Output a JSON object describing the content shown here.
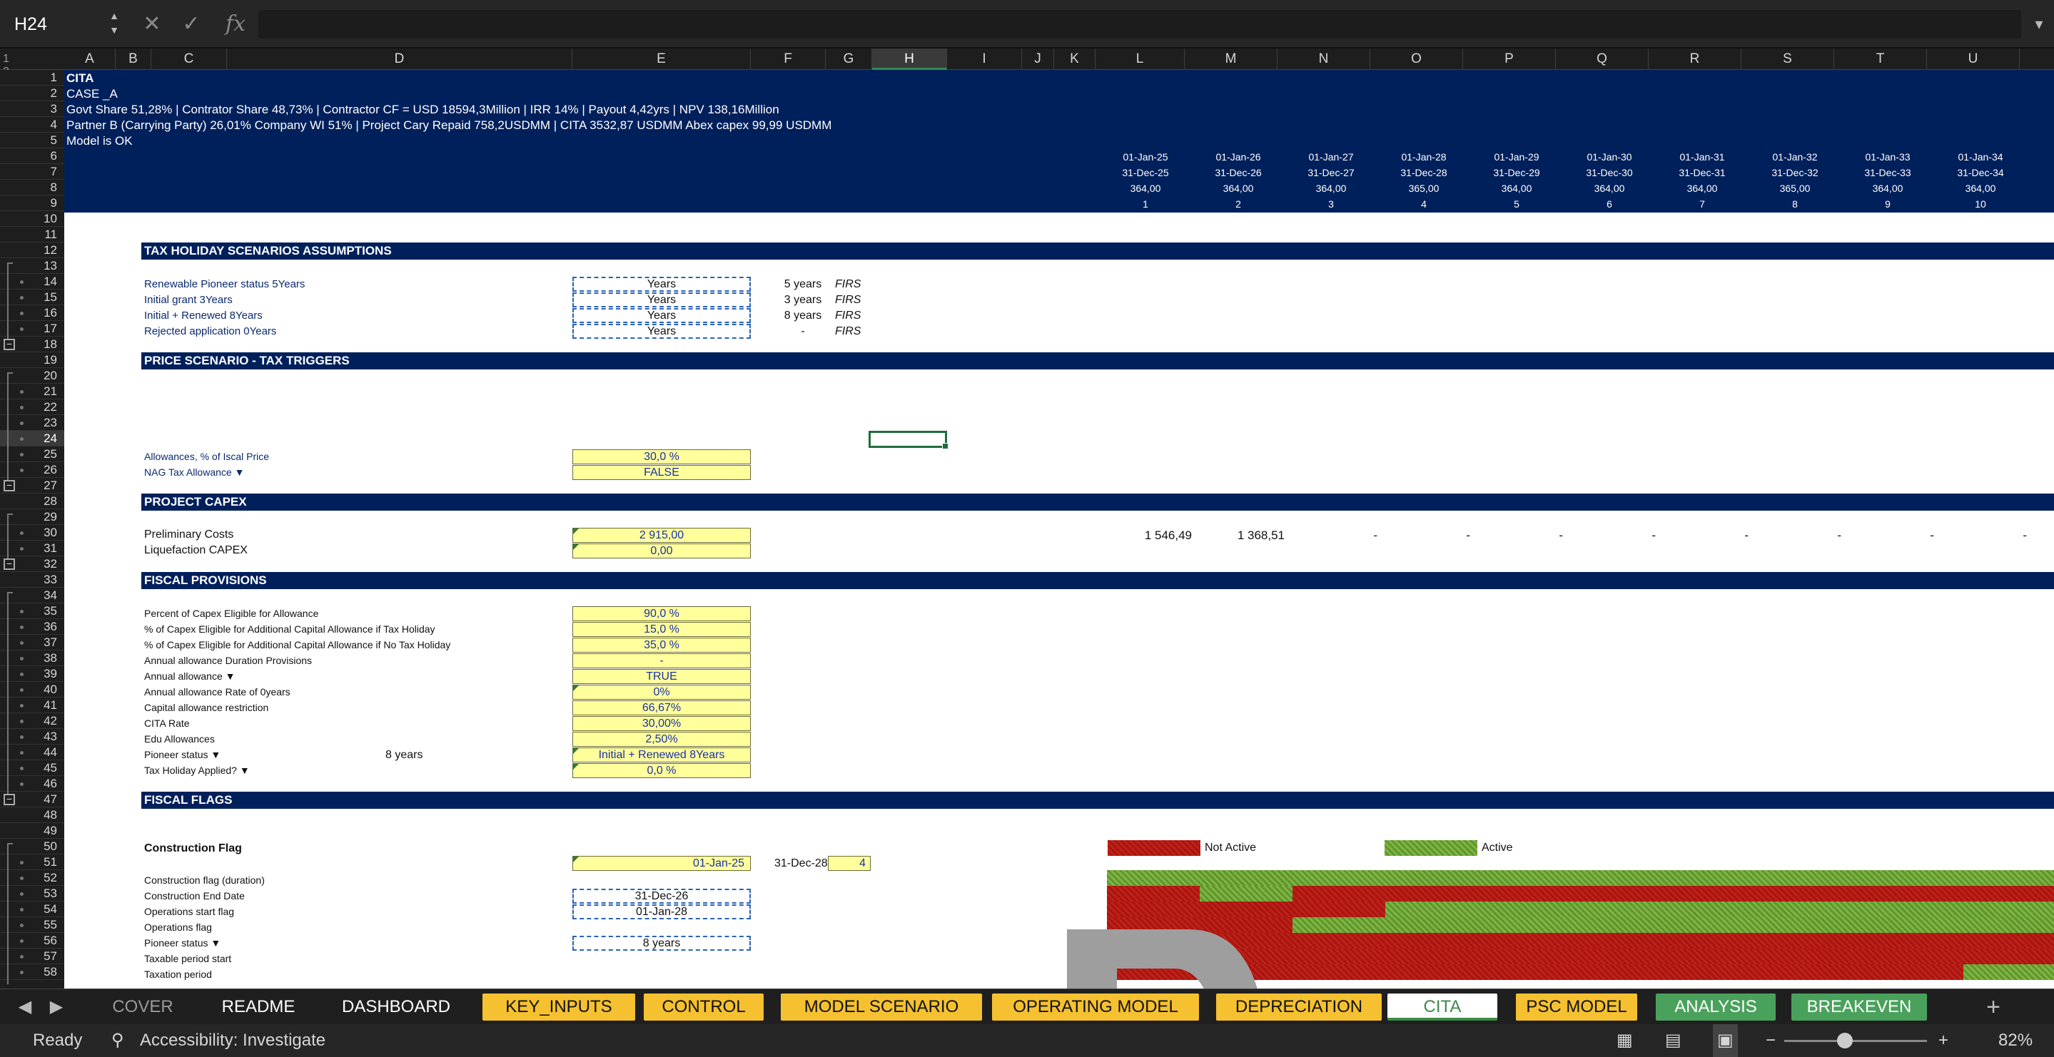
{
  "formula_bar": {
    "name_box": "H24",
    "cancel_icon": "✕",
    "enter_icon": "✓",
    "function_icon": "fx",
    "formula": ""
  },
  "columns": [
    "A",
    "B",
    "C",
    "D",
    "E",
    "F",
    "G",
    "H",
    "I",
    "J",
    "K",
    "L",
    "M",
    "N",
    "O",
    "P",
    "Q",
    "R",
    "S",
    "T",
    "U"
  ],
  "selected_column": "H",
  "outline_levels": "1 2",
  "rows": [
    "1",
    "2",
    "3",
    "4",
    "5",
    "6",
    "7",
    "8",
    "9",
    "10",
    "11",
    "12",
    "13",
    "14",
    "15",
    "16",
    "17",
    "18",
    "19",
    "20",
    "21",
    "22",
    "23",
    "24",
    "25",
    "26",
    "27",
    "28",
    "29",
    "30",
    "31",
    "32",
    "33",
    "34",
    "35",
    "36",
    "37",
    "38",
    "39",
    "40",
    "41",
    "42",
    "43",
    "44",
    "45",
    "46",
    "47",
    "48",
    "49",
    "50",
    "51",
    "52",
    "53",
    "54",
    "55",
    "56",
    "57",
    "58"
  ],
  "selected_row": "24",
  "header": {
    "line1": "CITA",
    "line2": "CASE _A",
    "line3": "Govt Share 51,28% | Contrator Share 48,73% |  Contractor CF = USD 18594,3Million | IRR 14% | Payout 4,42yrs | NPV 138,16Million",
    "line4": "Partner B (Carrying Party) 26,01% Company WI 51% |  Project Cary Repaid  758,2USDMM  |  CITA 3532,87  USDMM Abex capex 99,99  USDMM",
    "line5": "Model is OK"
  },
  "periods": [
    {
      "start": "01-Jan-25",
      "end": "31-Dec-25",
      "days": "364,00",
      "n": "1"
    },
    {
      "start": "01-Jan-26",
      "end": "31-Dec-26",
      "days": "364,00",
      "n": "2"
    },
    {
      "start": "01-Jan-27",
      "end": "31-Dec-27",
      "days": "364,00",
      "n": "3"
    },
    {
      "start": "01-Jan-28",
      "end": "31-Dec-28",
      "days": "365,00",
      "n": "4"
    },
    {
      "start": "01-Jan-29",
      "end": "31-Dec-29",
      "days": "364,00",
      "n": "5"
    },
    {
      "start": "01-Jan-30",
      "end": "31-Dec-30",
      "days": "364,00",
      "n": "6"
    },
    {
      "start": "01-Jan-31",
      "end": "31-Dec-31",
      "days": "364,00",
      "n": "7"
    },
    {
      "start": "01-Jan-32",
      "end": "31-Dec-32",
      "days": "365,00",
      "n": "8"
    },
    {
      "start": "01-Jan-33",
      "end": "31-Dec-33",
      "days": "364,00",
      "n": "9"
    },
    {
      "start": "01-Jan-34",
      "end": "31-Dec-34",
      "days": "364,00",
      "n": "10"
    }
  ],
  "sections": {
    "tax_holiday": "TAX HOLIDAY SCENARIOS ASSUMPTIONS",
    "price_scenario": "PRICE SCENARIO - TAX TRIGGERS",
    "project_capex": "PROJECT CAPEX",
    "fiscal_provisions": "FISCAL PROVISIONS",
    "fiscal_flags": "FISCAL FLAGS"
  },
  "tax_holiday_rows": [
    {
      "label": "Renewable Pioneer status 5Years",
      "value": "Years",
      "years": "5 years",
      "source": "FIRS"
    },
    {
      "label": "Initial grant 3Years",
      "value": "Years",
      "years": "3 years",
      "source": "FIRS"
    },
    {
      "label": "Initial + Renewed  8Years",
      "value": "Years",
      "years": "8 years",
      "source": "FIRS"
    },
    {
      "label": "Rejected application 0Years",
      "value": "Years",
      "years": "-",
      "source": "FIRS"
    }
  ],
  "price_rows": [
    {
      "label": "Allowances, % of Iscal Price",
      "value": "30,0 %"
    },
    {
      "label": "NAG Tax Allowance ▼",
      "value": "FALSE"
    }
  ],
  "capex_rows": [
    {
      "label": "Preliminary Costs",
      "value": "2 915,00",
      "v1": "1 546,49",
      "v2": "1 368,51",
      "rest": "-"
    },
    {
      "label": "Liquefaction CAPEX",
      "value": "0,00"
    }
  ],
  "fiscal_rows": [
    {
      "label": "Percent of Capex Eligible for Allowance",
      "value": "90,0 %"
    },
    {
      "label": "% of Capex Eligible for Additional Capital Allowance if Tax Holiday",
      "value": "15,0 %"
    },
    {
      "label": "% of Capex Eligible for Additional Capital Allowance if No Tax Holiday",
      "value": "35,0 %"
    },
    {
      "label": "Annual allowance Duration Provisions",
      "value": "-"
    },
    {
      "label": "Annual allowance ▼",
      "value": "TRUE"
    },
    {
      "label": "Annual allowance Rate of 0years",
      "value": "0%"
    },
    {
      "label": "Capital allowance restriction",
      "value": "66,67%"
    },
    {
      "label": "CITA Rate",
      "value": "30,00%"
    },
    {
      "label": "Edu Allowances",
      "value": "2,50%"
    },
    {
      "label": "Pioneer status ▼",
      "value": "Initial + Renewed  8Years",
      "extra": "8 years"
    },
    {
      "label": "Tax Holiday Applied? ▼",
      "value": "0,0 %"
    }
  ],
  "flags": {
    "construction_title": "Construction Flag",
    "start_value": "01-Jan-25",
    "end_text": "31-Dec-28",
    "count": "4",
    "legend_not_active": "Not Active",
    "legend_active": "Active",
    "rows": [
      {
        "label": "Construction flag (duration)",
        "value": ""
      },
      {
        "label": "Construction End Date",
        "value": "31-Dec-26"
      },
      {
        "label": "Operations start flag",
        "value": "01-Jan-28"
      },
      {
        "label": "Operations flag",
        "value": ""
      },
      {
        "label": "Pioneer status ▼",
        "value": "8 years"
      },
      {
        "label": "Taxable period start",
        "value": ""
      },
      {
        "label": "Taxation period",
        "value": ""
      }
    ]
  },
  "sheet_tabs": [
    {
      "label": "COVER",
      "style": "gray"
    },
    {
      "label": "README",
      "style": "navyt"
    },
    {
      "label": "DASHBOARD",
      "style": "navyt"
    },
    {
      "label": "KEY_INPUTS",
      "style": "yellow"
    },
    {
      "label": "CONTROL",
      "style": "yellow"
    },
    {
      "label": "MODEL SCENARIO",
      "style": "yellow"
    },
    {
      "label": "OPERATING MODEL",
      "style": "yellow"
    },
    {
      "label": "DEPRECIATION",
      "style": "yellow"
    },
    {
      "label": "CITA",
      "style": "active"
    },
    {
      "label": "PSC MODEL",
      "style": "yellow"
    },
    {
      "label": "ANALYSIS",
      "style": "green"
    },
    {
      "label": "BREAKEVEN",
      "style": "green"
    }
  ],
  "add_sheet": "+",
  "status": {
    "ready": "Ready",
    "accessibility": "Accessibility: Investigate",
    "zoom": "82%",
    "zoom_minus": "−",
    "zoom_plus": "+"
  },
  "colors": {
    "navy": "#00205b",
    "input_yellow": "#ffff9c",
    "flag_red": "#c0201a",
    "flag_green": "#7fb343",
    "active_tab": "#3c8b47"
  }
}
